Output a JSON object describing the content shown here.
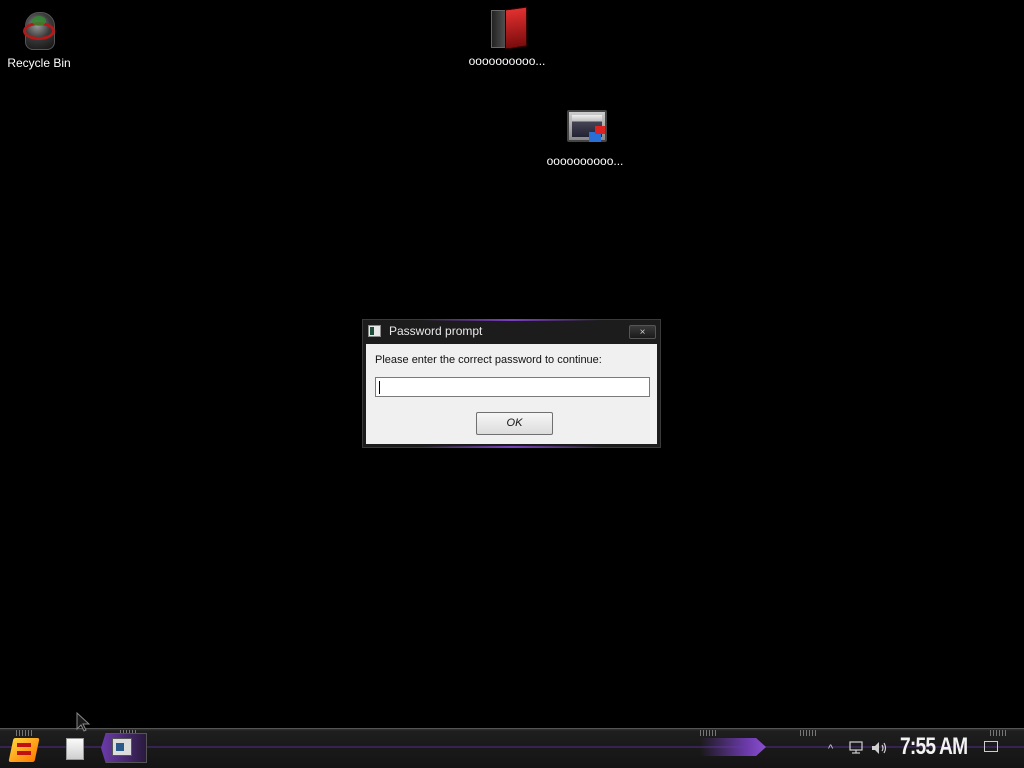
{
  "desktop": {
    "icons": [
      {
        "label": "Recycle Bin"
      },
      {
        "label": "oooooooooo..."
      },
      {
        "label": "oooooooooo..."
      }
    ]
  },
  "dialog": {
    "title": "Password prompt",
    "close_glyph": "×",
    "prompt": "Please enter the correct password to continue:",
    "password_value": "",
    "ok_label": "OK"
  },
  "taskbar": {
    "tray_chevron": "^",
    "clock": "7:55 AM"
  },
  "icons": {
    "start": "start-orb-icon",
    "quick_launch": "document-icon",
    "task": "password-prompt-app-icon",
    "network": "network-icon",
    "volume": "volume-icon",
    "notifications": "action-center-icon"
  },
  "colors": {
    "accent": "#6a3aa8",
    "desktop_bg": "#000000"
  }
}
